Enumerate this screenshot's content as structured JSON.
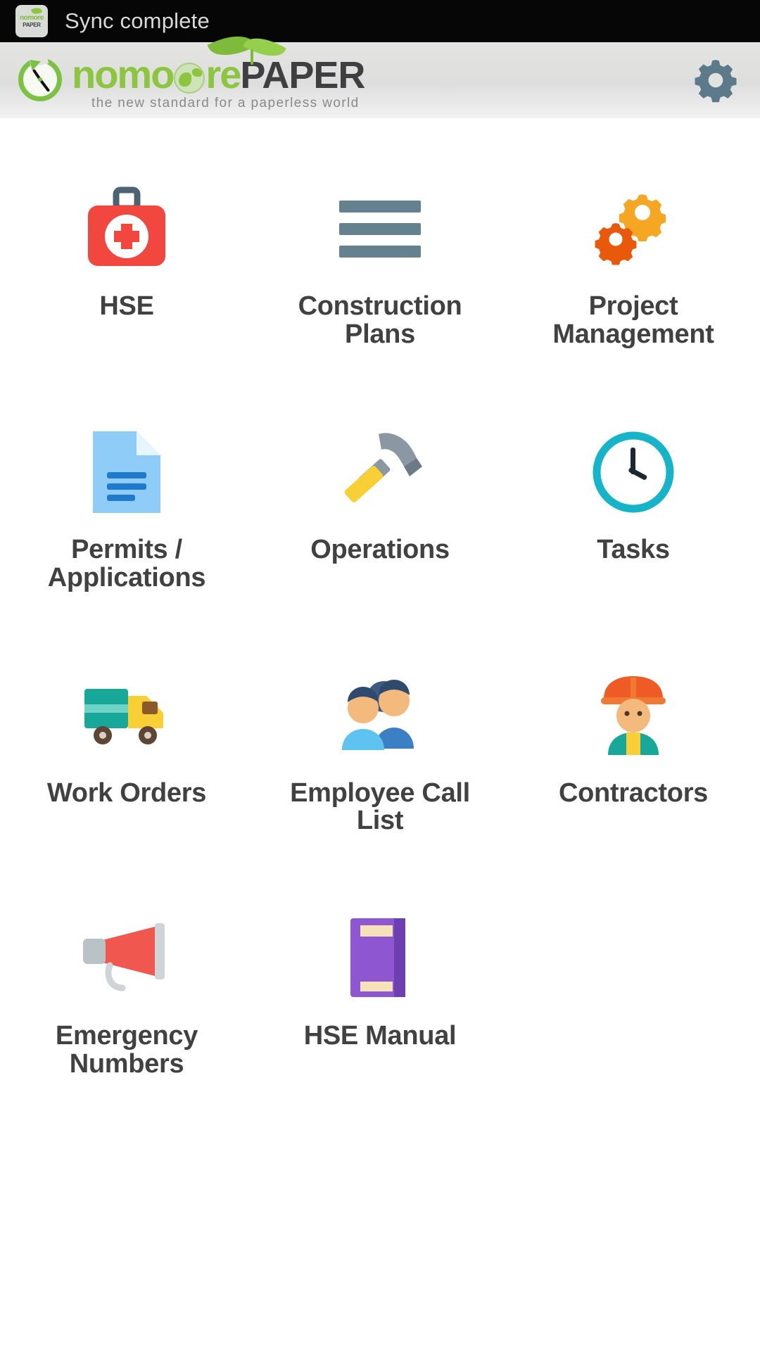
{
  "statusbar": {
    "app_icon": "nomorepaper-app-icon",
    "text": "Sync complete"
  },
  "header": {
    "logo_word1": "nomo",
    "logo_word2": "re",
    "logo_word3": "PAPER",
    "tagline": "the new standard for a paperless world",
    "settings_icon": "gear-icon",
    "colors": {
      "green": "#8cc63f",
      "dark": "#3f3f41",
      "gear": "#5c7a8a"
    }
  },
  "grid": {
    "items": [
      {
        "label": "HSE",
        "icon": "first-aid-kit-icon"
      },
      {
        "label": "Construction Plans",
        "icon": "horizontal-lines-icon"
      },
      {
        "label": "Project Management",
        "icon": "gears-icon"
      },
      {
        "label": "Permits / Applications",
        "icon": "document-icon"
      },
      {
        "label": "Operations",
        "icon": "hammer-icon"
      },
      {
        "label": "Tasks",
        "icon": "clock-icon"
      },
      {
        "label": "Work Orders",
        "icon": "truck-icon"
      },
      {
        "label": "Employee Call List",
        "icon": "people-icon"
      },
      {
        "label": "Contractors",
        "icon": "worker-icon"
      },
      {
        "label": "Emergency Numbers",
        "icon": "megaphone-icon"
      },
      {
        "label": "HSE Manual",
        "icon": "book-icon"
      }
    ]
  }
}
